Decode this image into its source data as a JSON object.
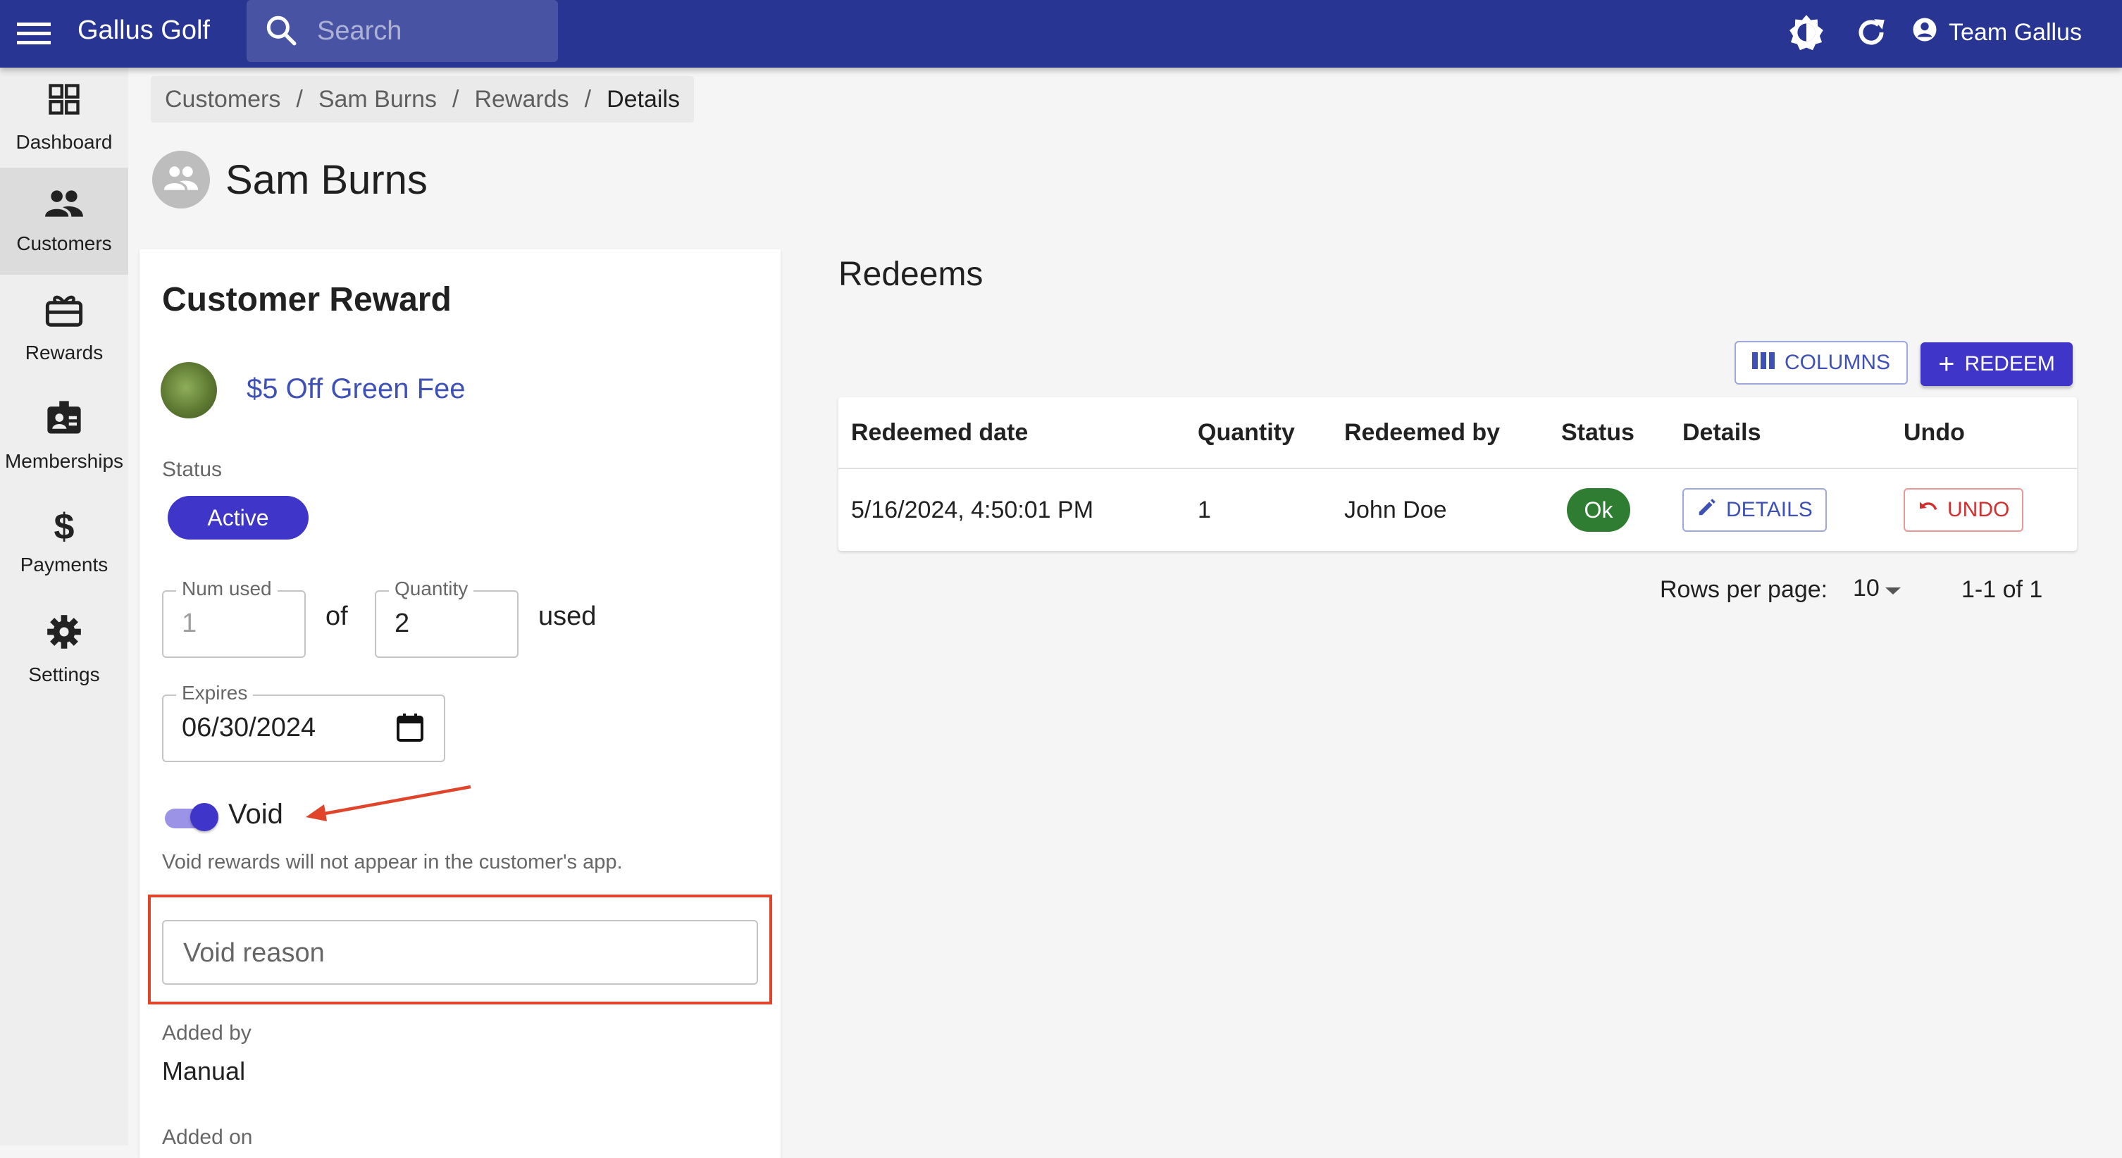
{
  "app": {
    "title": "Gallus Golf",
    "user": "Team Gallus"
  },
  "search": {
    "placeholder": "Search"
  },
  "sidebar": {
    "items": [
      {
        "label": "Dashboard",
        "icon": "dashboard-icon"
      },
      {
        "label": "Customers",
        "icon": "people-icon",
        "active": true
      },
      {
        "label": "Rewards",
        "icon": "gift-card-icon"
      },
      {
        "label": "Memberships",
        "icon": "badge-icon"
      },
      {
        "label": "Payments",
        "icon": "dollar-icon"
      },
      {
        "label": "Settings",
        "icon": "gear-icon"
      }
    ]
  },
  "breadcrumb": [
    "Customers",
    "Sam Burns",
    "Rewards",
    "Details"
  ],
  "customer": {
    "name": "Sam Burns"
  },
  "reward_card": {
    "title": "Customer Reward",
    "reward_name": "$5 Off Green Fee",
    "status_label": "Status",
    "status": "Active",
    "num_used_label": "Num used",
    "num_used": "1",
    "of_text": "of",
    "quantity_label": "Quantity",
    "quantity": "2",
    "used_text": "used",
    "expires_label": "Expires",
    "expires": "06/30/2024",
    "void_label": "Void",
    "void_on": true,
    "void_helper": "Void rewards will not appear in the customer's app.",
    "void_reason_placeholder": "Void reason",
    "added_by_label": "Added by",
    "added_by": "Manual",
    "added_on_label": "Added on"
  },
  "redeems": {
    "title": "Redeems",
    "columns_button": "COLUMNS",
    "redeem_button": "REDEEM",
    "headers": [
      "Redeemed date",
      "Quantity",
      "Redeemed by",
      "Status",
      "Details",
      "Undo"
    ],
    "rows": [
      {
        "date": "5/16/2024, 4:50:01 PM",
        "quantity": "1",
        "by": "John Doe",
        "status": "Ok",
        "details": "DETAILS",
        "undo": "UNDO"
      }
    ],
    "rows_per_page_label": "Rows per page:",
    "rows_per_page": "10",
    "range": "1-1 of 1"
  },
  "colors": {
    "appbar": "#283593",
    "primary": "#3f36c9",
    "link": "#3f51b5",
    "ok": "#2e7d32",
    "danger": "#d32f2f",
    "annotation": "#e0452b"
  }
}
